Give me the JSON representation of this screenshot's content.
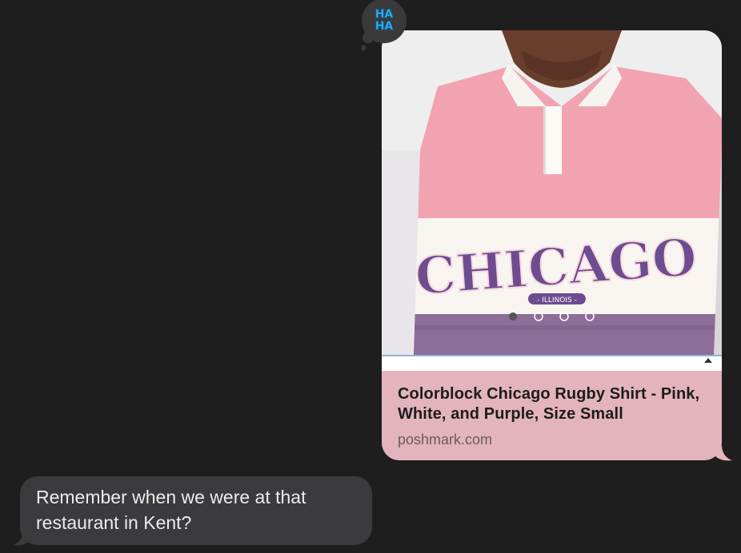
{
  "tapback": {
    "label_line1": "HA",
    "label_line2": "HA",
    "icon": "haha-tapback-icon",
    "color": "#32b7f5"
  },
  "link_preview": {
    "title": "Colorblock Chicago Rugby Shirt - Pink, White, and Purple, Size Small",
    "domain": "poshmark.com",
    "bubble_color": "#e3b4bd",
    "image": {
      "description_icon": "product-photo",
      "shirt_text": "CHICAGO",
      "shirt_subtext": "- ILLINOIS -",
      "carousel_dots": 4,
      "carousel_active_index": 0
    }
  },
  "received_message": {
    "text": "Remember when we were at that restaurant in Kent?",
    "bubble_color": "#3b3b3d"
  }
}
